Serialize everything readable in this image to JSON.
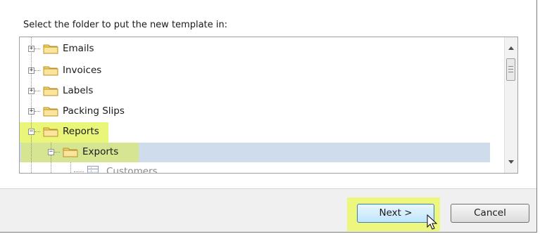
{
  "dialog": {
    "prompt": "Select the folder to put the new template in:",
    "tree": {
      "items": [
        {
          "label": "Emails",
          "expander": "+",
          "icon": "folder-icon"
        },
        {
          "label": "Invoices",
          "expander": "+",
          "icon": "folder-icon"
        },
        {
          "label": "Labels",
          "expander": "+",
          "icon": "folder-icon"
        },
        {
          "label": "Packing Slips",
          "expander": "+",
          "icon": "folder-icon"
        },
        {
          "label": "Reports",
          "expander": "−",
          "icon": "folder-icon",
          "highlighted": true
        },
        {
          "label": "Exports",
          "expander": "−",
          "icon": "folder-icon",
          "selected": true,
          "highlighted": true
        },
        {
          "label": "Customers",
          "icon": "table-icon",
          "partially_visible": true
        }
      ]
    },
    "buttons": {
      "next": "Next >",
      "cancel": "Cancel"
    }
  },
  "colors": {
    "highlight": "#eaf679",
    "selection": "#cfdcec",
    "folder": "#f5d264"
  }
}
